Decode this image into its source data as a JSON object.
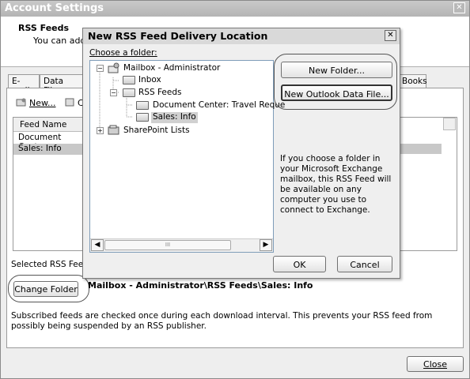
{
  "window": {
    "title": "Account Settings"
  },
  "header": {
    "title": "RSS Feeds",
    "description": "You can add o"
  },
  "tabs": [
    {
      "label": "E-mail"
    },
    {
      "label": "Data Files"
    },
    {
      "label": "Books"
    }
  ],
  "toolbar": {
    "new_label": "New...",
    "change_prefix": "C"
  },
  "feed_list": {
    "column_header": "Feed Name",
    "rows": [
      "Document Center",
      "Sales: Info"
    ]
  },
  "selected_feed_label": "Selected RSS Feed",
  "change_folder_button": "Change Folder",
  "selected_path": "Mailbox - Administrator\\RSS Feeds\\Sales: Info",
  "note": "Subscribed feeds are checked once during each download interval. This prevents your RSS feed from possibly being suspended by an RSS publisher.",
  "close_button": "Close",
  "dialog": {
    "title": "New RSS Feed Delivery Location",
    "choose_label": "Choose a folder:",
    "tree": {
      "mailbox": "Mailbox - Administrator",
      "inbox": "Inbox",
      "rss_feeds": "RSS Feeds",
      "doc_center": "Document Center: Travel Reque",
      "sales_info": "Sales: Info",
      "sharepoint": "SharePoint Lists"
    },
    "new_folder_button": "New Folder...",
    "new_data_file_button": "New Outlook Data File...",
    "info": "If you choose a folder in your Microsoft Exchange mailbox, this RSS Feed will be available on any computer you use to connect to Exchange.",
    "ok_button": "OK",
    "cancel_button": "Cancel"
  }
}
